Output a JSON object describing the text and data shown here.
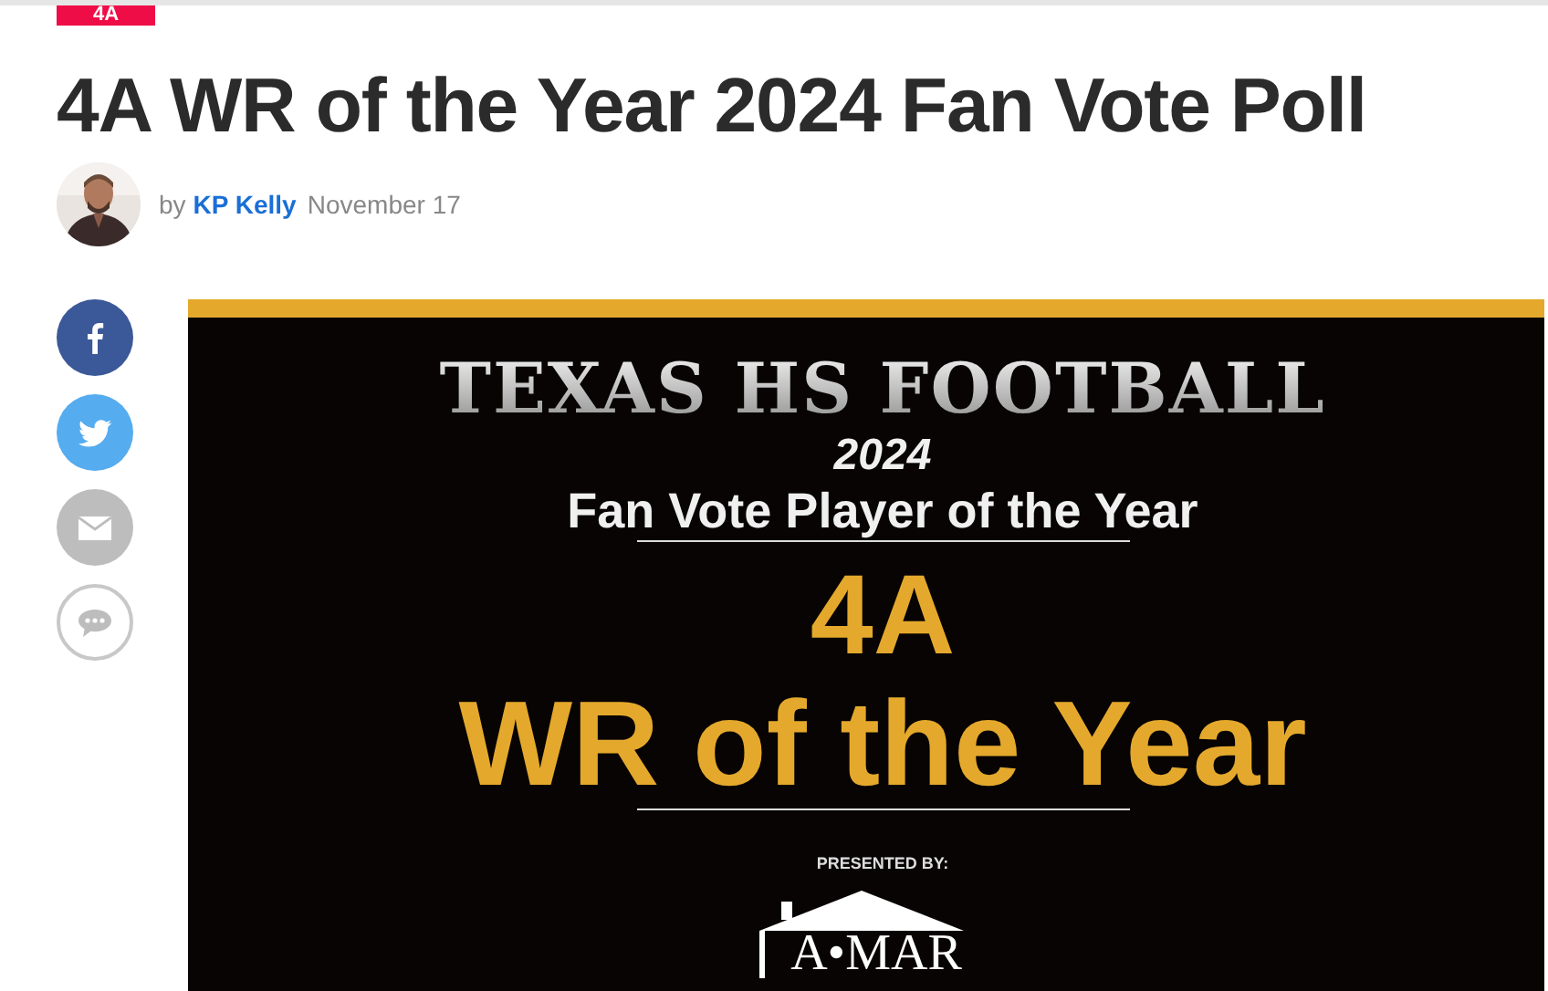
{
  "category_tag": "4A",
  "title": "4A WR of the Year 2024 Fan Vote Poll",
  "byline": {
    "prefix": "by",
    "author": "KP Kelly",
    "date": "November 17"
  },
  "share_buttons": [
    {
      "kind": "facebook"
    },
    {
      "kind": "twitter"
    },
    {
      "kind": "email"
    },
    {
      "kind": "comments"
    }
  ],
  "banner": {
    "heading": "TEXAS HS FOOTBALL",
    "year": "2024",
    "subtitle": "Fan Vote Player of the Year",
    "classification": "4A",
    "award": "WR of the Year",
    "presented_by": "PRESENTED BY:",
    "sponsor_logo": "A•MAR"
  }
}
